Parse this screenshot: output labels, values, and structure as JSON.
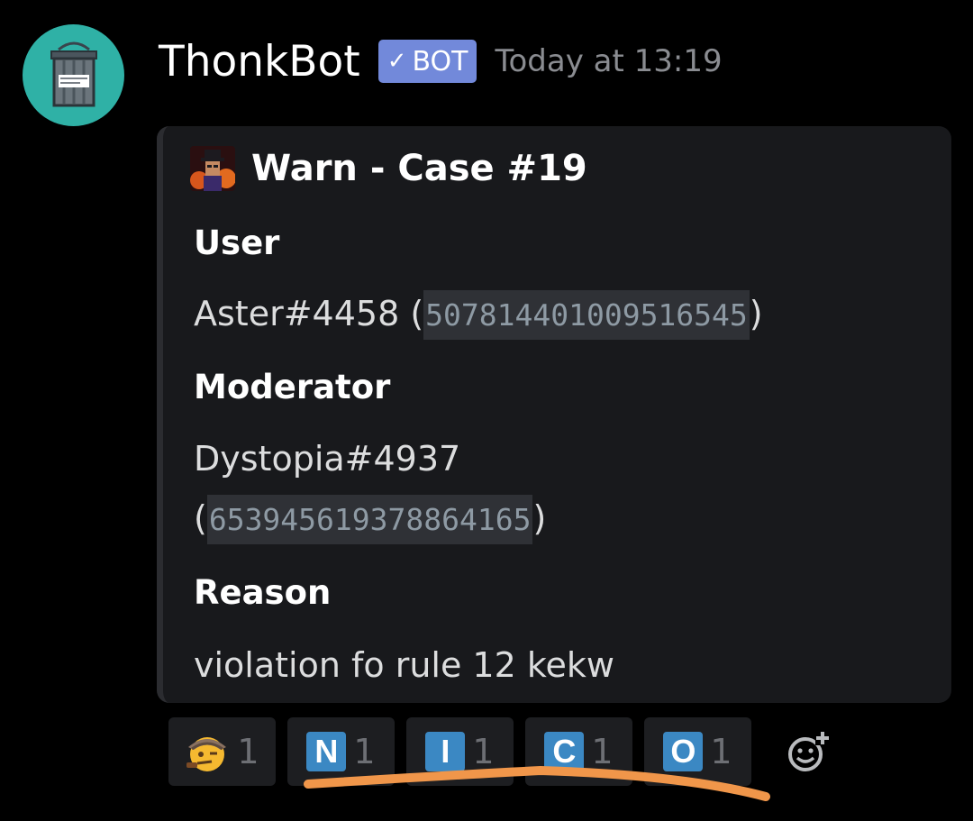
{
  "message": {
    "author": "ThonkBot",
    "bot_tag": "BOT",
    "timestamp": "Today at 13:19"
  },
  "embed": {
    "title": "Warn - Case #19",
    "fields": [
      {
        "name": "User",
        "value_text": "Aster#4458",
        "value_id": "507814401009516545"
      },
      {
        "name": "Moderator",
        "value_text": "Dystopia#4937",
        "value_id": "653945619378864165"
      },
      {
        "name": "Reason",
        "value_text": "violation fo rule 12 kekw"
      }
    ]
  },
  "reactions": [
    {
      "emoji": "detective-face",
      "count": "1"
    },
    {
      "letter": "N",
      "count": "1"
    },
    {
      "letter": "I",
      "count": "1"
    },
    {
      "letter": "C",
      "count": "1"
    },
    {
      "letter": "O",
      "count": "1"
    }
  ],
  "colors": {
    "accent": "#7289da",
    "avatar_bg": "#2fb1a6",
    "letter_tile": "#3b88c3",
    "underline": "#f0964a"
  }
}
